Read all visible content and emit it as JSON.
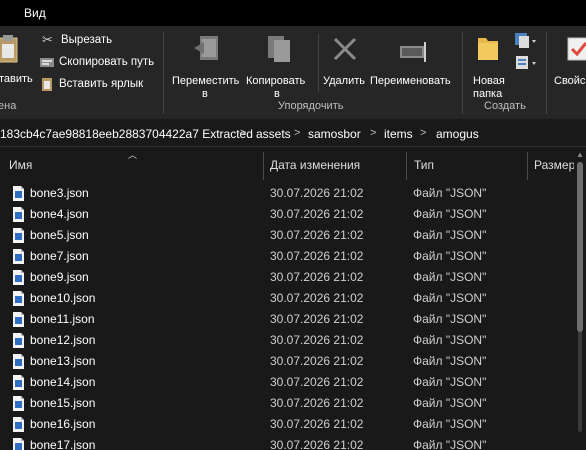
{
  "menubar": {
    "view_tab": "Вид"
  },
  "ribbon": {
    "clipboard": {
      "paste_label": "тавить",
      "cut_label": "Вырезать",
      "copy_path_label": "Скопировать путь",
      "paste_shortcut_label": "Вставить ярлык",
      "group_label": "ена"
    },
    "organize": {
      "move_label_1": "Переместить",
      "move_label_2": "в",
      "copy_label_1": "Копировать",
      "copy_label_2": "в",
      "delete_label": "Удалить",
      "rename_label": "Переименовать",
      "group_label": "Упорядочить"
    },
    "create": {
      "new_folder_label_1": "Новая",
      "new_folder_label_2": "папка",
      "group_label": "Создать"
    },
    "open": {
      "properties_label": "Свойс"
    }
  },
  "address": {
    "segments": [
      "183cb4c7ae98818eeb2883704422a7 Extracted",
      "assets",
      "samosbor",
      "items",
      "amogus"
    ],
    "separator": ">"
  },
  "columns": {
    "name": "Имя",
    "date": "Дата изменения",
    "type": "Тип",
    "size": "Размер"
  },
  "files": [
    {
      "name": "bone3.json",
      "date": "30.07.2026 21:02",
      "type": "Файл \"JSON\""
    },
    {
      "name": "bone4.json",
      "date": "30.07.2026 21:02",
      "type": "Файл \"JSON\""
    },
    {
      "name": "bone5.json",
      "date": "30.07.2026 21:02",
      "type": "Файл \"JSON\""
    },
    {
      "name": "bone7.json",
      "date": "30.07.2026 21:02",
      "type": "Файл \"JSON\""
    },
    {
      "name": "bone9.json",
      "date": "30.07.2026 21:02",
      "type": "Файл \"JSON\""
    },
    {
      "name": "bone10.json",
      "date": "30.07.2026 21:02",
      "type": "Файл \"JSON\""
    },
    {
      "name": "bone11.json",
      "date": "30.07.2026 21:02",
      "type": "Файл \"JSON\""
    },
    {
      "name": "bone12.json",
      "date": "30.07.2026 21:02",
      "type": "Файл \"JSON\""
    },
    {
      "name": "bone13.json",
      "date": "30.07.2026 21:02",
      "type": "Файл \"JSON\""
    },
    {
      "name": "bone14.json",
      "date": "30.07.2026 21:02",
      "type": "Файл \"JSON\""
    },
    {
      "name": "bone15.json",
      "date": "30.07.2026 21:02",
      "type": "Файл \"JSON\""
    },
    {
      "name": "bone16.json",
      "date": "30.07.2026 21:02",
      "type": "Файл \"JSON\""
    },
    {
      "name": "bone17.json",
      "date": "30.07.2026 21:02",
      "type": "Файл \"JSON\""
    }
  ],
  "colors": {
    "background": "#191919",
    "ribbon": "#262626",
    "folder_yellow": "#e8b84a",
    "accent_red": "#e04a3a"
  }
}
